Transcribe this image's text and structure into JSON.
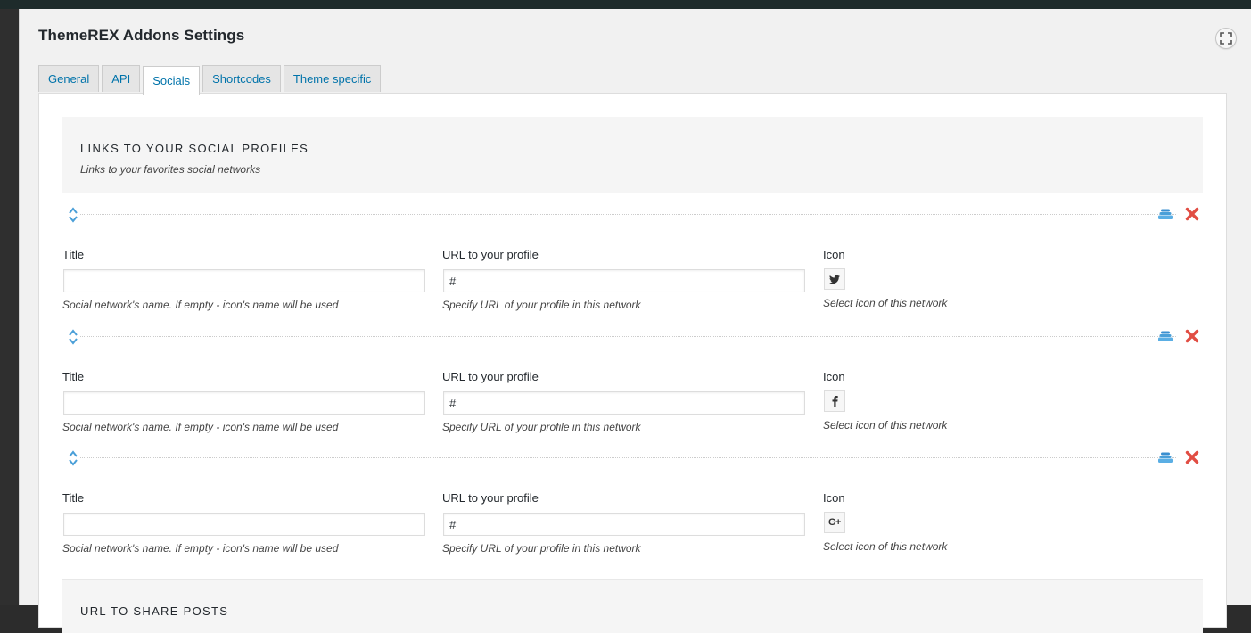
{
  "page": {
    "title": "ThemeREX Addons Settings"
  },
  "tabs": [
    {
      "label": "General",
      "active": false
    },
    {
      "label": "API",
      "active": false
    },
    {
      "label": "Socials",
      "active": true
    },
    {
      "label": "Shortcodes",
      "active": false
    },
    {
      "label": "Theme specific",
      "active": false
    }
  ],
  "socials_section": {
    "title": "LINKS TO YOUR SOCIAL PROFILES",
    "description": "Links to your favorites social networks"
  },
  "fields": {
    "title_label": "Title",
    "title_hint": "Social network's name. If empty - icon's name will be used",
    "url_label": "URL to your profile",
    "url_hint": "Specify URL of your profile in this network",
    "icon_label": "Icon",
    "icon_hint": "Select icon of this network"
  },
  "items": [
    {
      "title": "",
      "url": "#",
      "icon": "twitter-icon",
      "icon_glyph": "t"
    },
    {
      "title": "",
      "url": "#",
      "icon": "facebook-icon",
      "icon_glyph": "f"
    },
    {
      "title": "",
      "url": "#",
      "icon": "google-plus-icon",
      "icon_glyph": "G+"
    }
  ],
  "share_section": {
    "title": "URL TO SHARE POSTS"
  },
  "colors": {
    "link_blue": "#0073aa",
    "delete_red": "#e14d43",
    "move_blue": "#4a9fd8"
  }
}
